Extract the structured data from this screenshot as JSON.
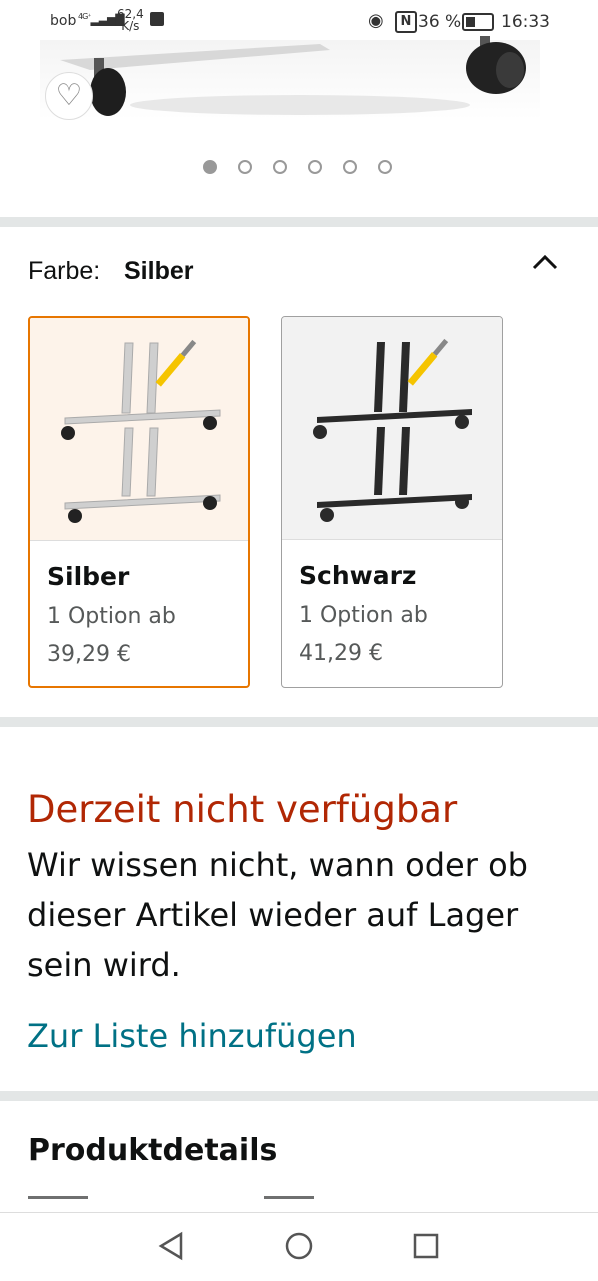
{
  "status_bar": {
    "carrier": "bob",
    "network": "4G⁺",
    "speed_value": "62,4",
    "speed_unit": "K/s",
    "battery": "36 %",
    "time": "16:33",
    "battery_level": 0.36
  },
  "gallery": {
    "dot_count": 6,
    "active_index": 0
  },
  "color_selector": {
    "label": "Farbe:",
    "selected": "Silber",
    "options": [
      {
        "name": "Silber",
        "sub": "1 Option ab",
        "price": "39,29 €",
        "selected": true
      },
      {
        "name": "Schwarz",
        "sub": "1 Option ab",
        "price": "41,29 €",
        "selected": false
      }
    ]
  },
  "availability": {
    "status": "Derzeit nicht verfügbar",
    "description": "Wir wissen nicht, wann oder ob dieser Artikel wieder auf Lager sein wird.",
    "add_to_list": "Zur Liste hinzufügen"
  },
  "product_details": {
    "title": "Produktdetails"
  },
  "colors": {
    "accent": "#e77600",
    "link": "#007185",
    "unavailable": "#b12704",
    "divider": "#e3e6e6"
  },
  "icons": {
    "favorite": "heart-outline-icon",
    "collapse": "chevron-up-icon",
    "back": "nav-back-icon",
    "home": "nav-home-icon",
    "recents": "nav-recents-icon"
  }
}
